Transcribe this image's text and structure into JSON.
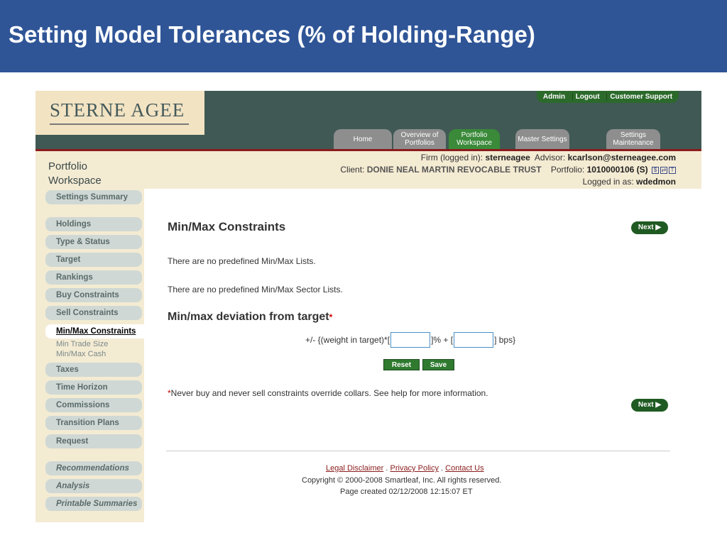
{
  "slide": {
    "title": "Setting Model Tolerances (% of Holding-Range)"
  },
  "logo": {
    "text": "STERNE AGEE"
  },
  "top_links": [
    "Admin",
    "Logout",
    "Customer Support"
  ],
  "tabs": [
    {
      "label": "Home",
      "active": false
    },
    {
      "label": "Overview of Portfolios",
      "active": false
    },
    {
      "label": "Portfolio Workspace",
      "active": true
    },
    {
      "label": "Master Settings",
      "active": false
    },
    {
      "label": "Settings Maintenance",
      "active": false
    }
  ],
  "section_title": "Portfolio Workspace",
  "info": {
    "firm_label": "Firm (logged in):",
    "firm": "sterneagee",
    "advisor_label": "Advisor:",
    "advisor": "kcarlson@sterneagee.com",
    "client_label": "Client:",
    "client": "DONIE NEAL MARTIN REVOCABLE TRUST",
    "portfolio_label": "Portfolio:",
    "portfolio": "1010000106 (S)",
    "logged_label": "Logged in as:",
    "logged_user": "wdedmon",
    "icons": [
      "$",
      "⇄",
      "T"
    ]
  },
  "sidebar": {
    "summary": "Settings Summary",
    "items": [
      "Holdings",
      "Type & Status",
      "Target",
      "Rankings",
      "Buy Constraints",
      "Sell Constraints",
      "Min/Max Constraints"
    ],
    "sub_items": [
      "Min Trade Size",
      "Min/Max Cash"
    ],
    "items2": [
      "Taxes",
      "Time Horizon",
      "Commissions",
      "Transition Plans",
      "Request"
    ],
    "bottom": [
      "Recommendations",
      "Analysis",
      "Printable Summaries"
    ]
  },
  "main": {
    "title": "Min/Max Constraints",
    "next_label": "Next",
    "no_lists": "There are no predefined Min/Max Lists.",
    "no_sector_lists": "There are no predefined Min/Max Sector Lists.",
    "deviation_title": "Min/max deviation from target",
    "asterisk": "*",
    "formula_prefix": "+/- {(weight in target)*[",
    "formula_mid": "]% + [",
    "formula_suffix": "] bps}",
    "pct_value": "",
    "bps_value": "",
    "reset_label": "Reset",
    "save_label": "Save",
    "note": "Never buy and never sell constraints override collars. See help for more information."
  },
  "footer": {
    "links": [
      "Legal Disclaimer",
      "Privacy Policy",
      "Contact Us"
    ],
    "separator": ".",
    "copyright": "Copyright © 2000-2008 Smartleaf, Inc. All rights reserved.",
    "page_created": "Page created 02/12/2008 12:15:07 ET"
  }
}
